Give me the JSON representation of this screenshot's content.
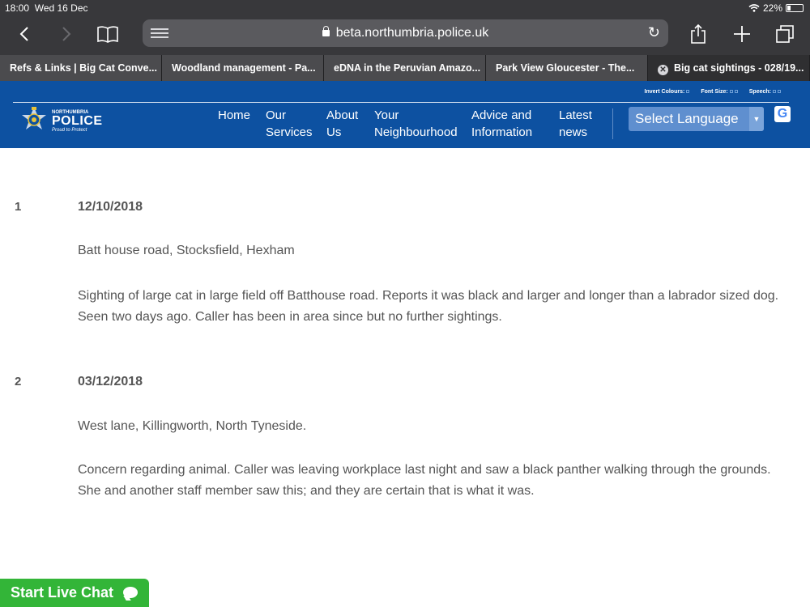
{
  "status_bar": {
    "time": "18:00",
    "date": "Wed 16 Dec",
    "battery": "22%",
    "battery_level": 0.22
  },
  "browser": {
    "url": "beta.northumbria.police.uk",
    "tabs": [
      {
        "label": "Refs & Links | Big Cat Conve..."
      },
      {
        "label": "Woodland management - Pa..."
      },
      {
        "label": "eDNA in the Peruvian Amazo..."
      },
      {
        "label": "Park View Gloucester - The..."
      },
      {
        "label": "Big cat sightings - 028/19...",
        "active": true
      }
    ]
  },
  "site": {
    "logo": {
      "name_small": "NORTHUMBRIA",
      "name_big": "POLICE",
      "tagline": "Proud to Protect"
    },
    "accessibility": {
      "invert": "Invert Colours:",
      "font": "Font Size:",
      "speech": "Speech:"
    },
    "nav": {
      "home": "Home",
      "services_1": "Our",
      "services_2": "Services",
      "about_1": "About",
      "about_2": "Us",
      "neigh_1": "Your",
      "neigh_2": "Neighbourhood",
      "advice_1": "Advice and",
      "advice_2": "Information",
      "news_1": "Latest",
      "news_2": "news"
    },
    "language_select": "Select Language",
    "google_icon": "G"
  },
  "entries": [
    {
      "num": "1",
      "date": "12/10/2018",
      "location": "Batt house road, Stocksfield, Hexham",
      "desc_1": "Sighting of large cat in large field off Batthouse road. Reports it was black and larger and longer than a labrador sized dog.",
      "desc_2": "Seen two days ago. Caller has been in area since but no further sightings."
    },
    {
      "num": "2",
      "date": "03/12/2018",
      "location": "West lane, Killingworth, North Tyneside.",
      "desc_1": "Concern regarding animal. Caller was leaving  workplace last night and saw a black panther walking through the grounds.",
      "desc_2": "She and another staff member saw this; and they are certain that is what it was."
    }
  ],
  "chat": {
    "label": "Start Live Chat"
  }
}
